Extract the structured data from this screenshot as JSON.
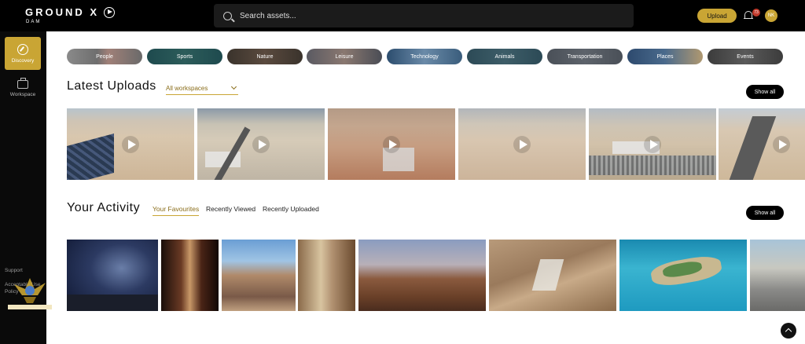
{
  "brand": {
    "name": "GROUND X",
    "sub": "DAM"
  },
  "search": {
    "placeholder": "Search assets..."
  },
  "header": {
    "upload_label": "Upload",
    "notification_count": "73",
    "avatar_initials": "NK"
  },
  "sidebar": {
    "items": [
      {
        "label": "Discovery",
        "icon": "compass-icon",
        "active": true
      },
      {
        "label": "Workspace",
        "icon": "briefcase-icon",
        "active": false
      }
    ],
    "links": [
      "Support",
      "Acceptable Use Policy"
    ],
    "logo_text": "عالم المال والأعمال"
  },
  "categories": [
    "People",
    "Sports",
    "Nature",
    "Leisure",
    "Technology",
    "Animals",
    "Transportation",
    "Places",
    "Events"
  ],
  "latest": {
    "title": "Latest Uploads",
    "workspace_filter": "All workspaces",
    "show_all": "Show all"
  },
  "activity": {
    "title": "Your Activity",
    "tabs": [
      "Your Favourites",
      "Recently Viewed",
      "Recently Uploaded"
    ],
    "active_tab": 0,
    "show_all": "Show all"
  },
  "colors": {
    "accent": "#c9a534",
    "topbar": "#000000",
    "sidebar": "#0a0a0a"
  }
}
